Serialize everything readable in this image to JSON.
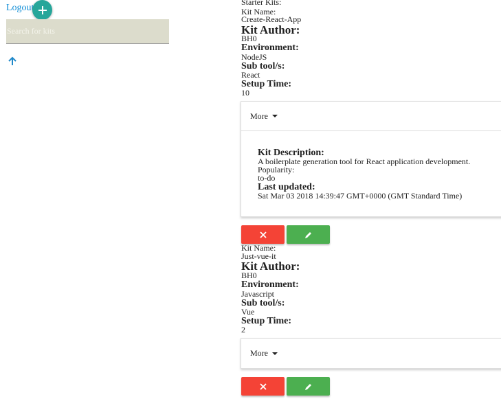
{
  "nav": {
    "logout_label": "Logout",
    "add_label": "+",
    "search_placeholder": "Search for kits",
    "up_icon": "arrow-up-icon"
  },
  "section_title": "Starter Kits:",
  "labels": {
    "kit_name": "Kit Name:",
    "kit_author": "Kit Author:",
    "environment": "Environment:",
    "sub_tools": "Sub tool/s:",
    "setup_time": "Setup Time:",
    "more": "More",
    "kit_description": "Kit Description:",
    "popularity": "Popularity:",
    "last_updated": "Last updated:"
  },
  "kits": [
    {
      "name": "Create-React-App",
      "author": "BH0",
      "environment": "NodeJS",
      "sub_tools": "React",
      "setup_time": "10",
      "expanded": true,
      "description": "A boilerplate generation tool for React application development.",
      "popularity": "to-do",
      "last_updated": "Sat Mar 03 2018 14:39:47 GMT+0000 (GMT Standard Time)"
    },
    {
      "name": "Just-vue-it",
      "author": "BH0",
      "environment": "Javascript",
      "sub_tools": "Vue",
      "setup_time": "2",
      "expanded": false
    }
  ],
  "colors": {
    "delete": "#f44336",
    "edit": "#4caf50",
    "add": "#26a69a",
    "link": "#0b8bd6"
  }
}
